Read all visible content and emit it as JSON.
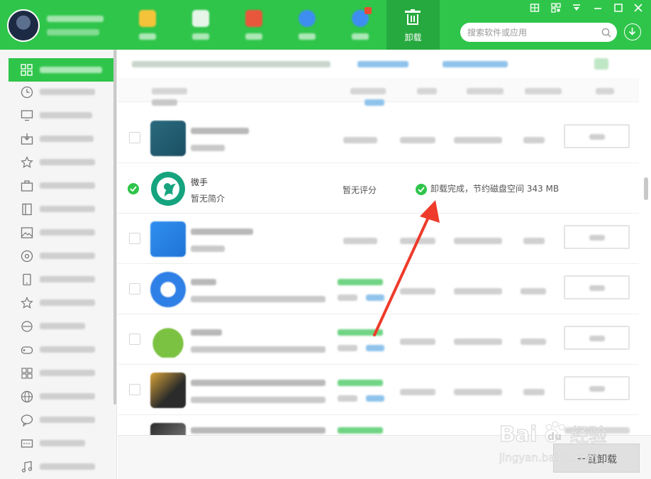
{
  "nav": {
    "tabs": [
      {
        "label": "",
        "icon": "game-icon"
      },
      {
        "label": "",
        "icon": "software-icon"
      },
      {
        "label": "",
        "icon": "book-icon"
      },
      {
        "label": "",
        "icon": "update-icon"
      },
      {
        "label": "",
        "icon": "upgrade-icon"
      },
      {
        "label": "卸载",
        "icon": "trash-icon"
      }
    ],
    "active_tab": "卸载"
  },
  "search": {
    "placeholder": "搜索软件或应用"
  },
  "app_list": {
    "items": [
      {
        "name": "",
        "desc": "",
        "status": "blurred"
      },
      {
        "name": "",
        "desc": "",
        "status": "blurred"
      },
      {
        "name": "微手",
        "desc": "暂无简介",
        "rating": "暂无评分",
        "result": "卸载完成，节约磁盘空间 343 MB",
        "checked": true
      },
      {
        "name": "",
        "desc": "",
        "status": "blurred"
      },
      {
        "name": "",
        "desc": "",
        "status": "blurred"
      },
      {
        "name": "",
        "desc": "",
        "status": "blurred"
      },
      {
        "name": "",
        "desc": "",
        "status": "blurred"
      }
    ]
  },
  "footer": {
    "uninstall_label": "一键卸载"
  },
  "colors": {
    "brand": "#2fc54a",
    "brand_dark": "#26a93f",
    "arrow": "#ee3b2b"
  }
}
